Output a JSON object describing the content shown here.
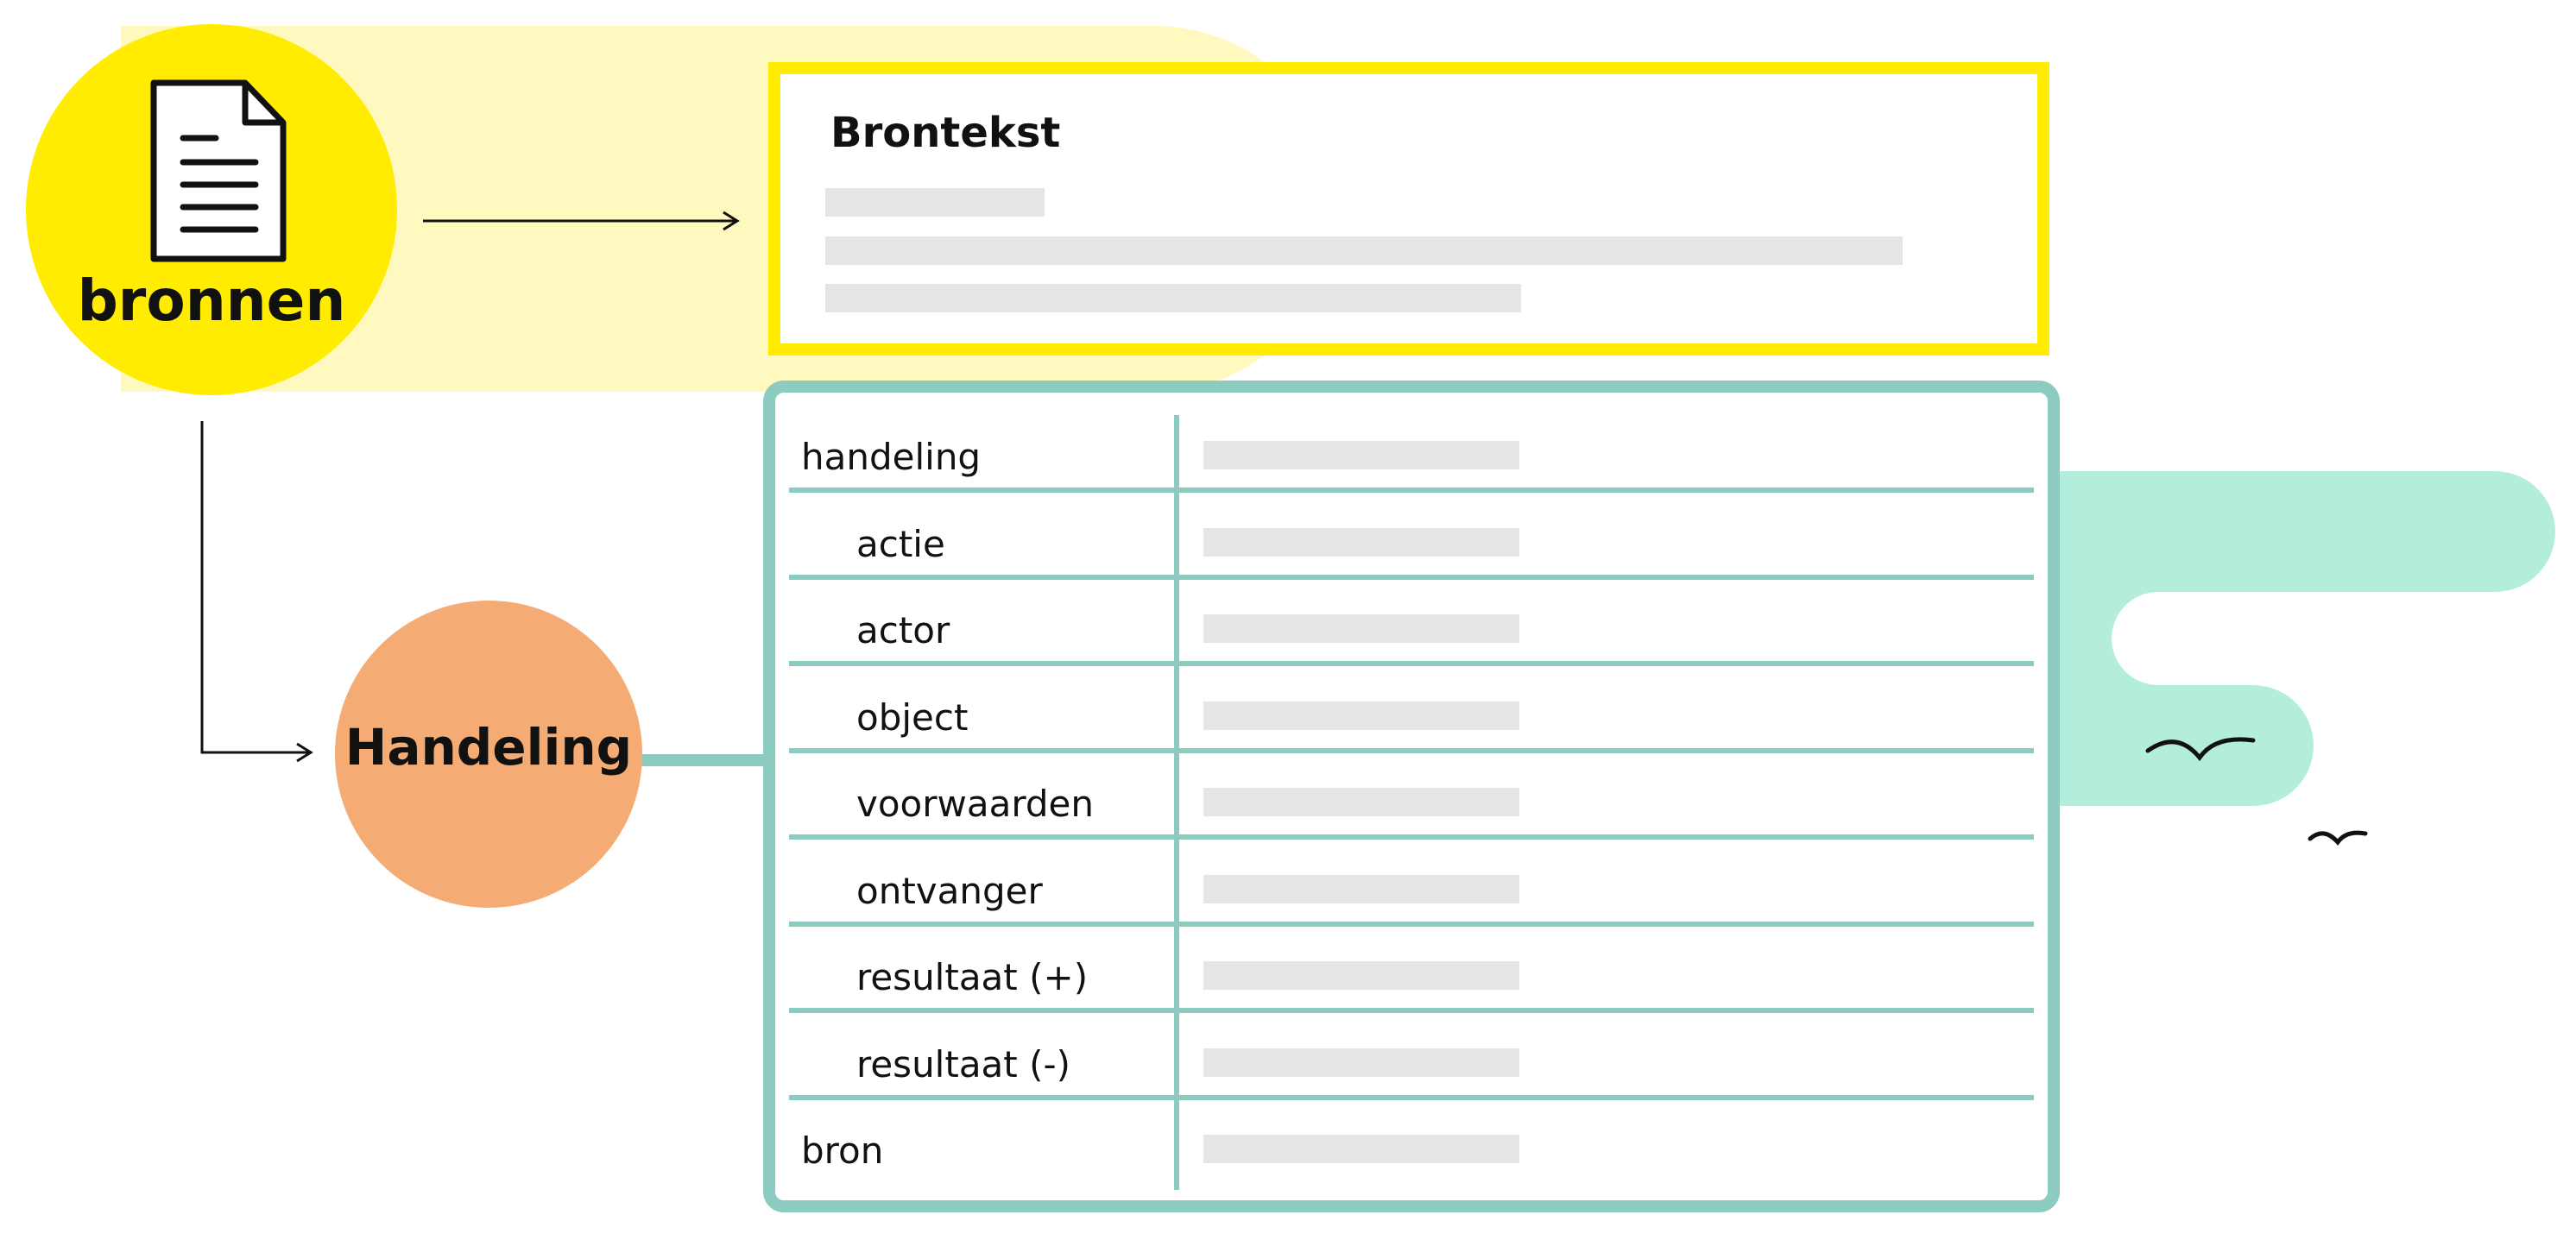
{
  "diagram": {
    "source_node": {
      "label": "bronnen",
      "icon": "document-icon"
    },
    "source_text_panel": {
      "title": "Brontekst"
    },
    "action_node": {
      "label": "Handeling"
    },
    "properties": [
      {
        "label": "handeling",
        "indent": false
      },
      {
        "label": "actie",
        "indent": true
      },
      {
        "label": "actor",
        "indent": true
      },
      {
        "label": "object",
        "indent": true
      },
      {
        "label": "voorwaarden",
        "indent": true
      },
      {
        "label": "ontvanger",
        "indent": true
      },
      {
        "label": "resultaat (+)",
        "indent": true
      },
      {
        "label": "resultaat (-)",
        "indent": true
      },
      {
        "label": "bron",
        "indent": false
      }
    ]
  },
  "colors": {
    "yellow": "#ffec00",
    "pale_yellow": "#fff8bf",
    "orange": "#f4ab74",
    "teal": "#8ccbbf",
    "mint": "#b2eedb",
    "placeholder_gray": "#e5e5e5"
  }
}
